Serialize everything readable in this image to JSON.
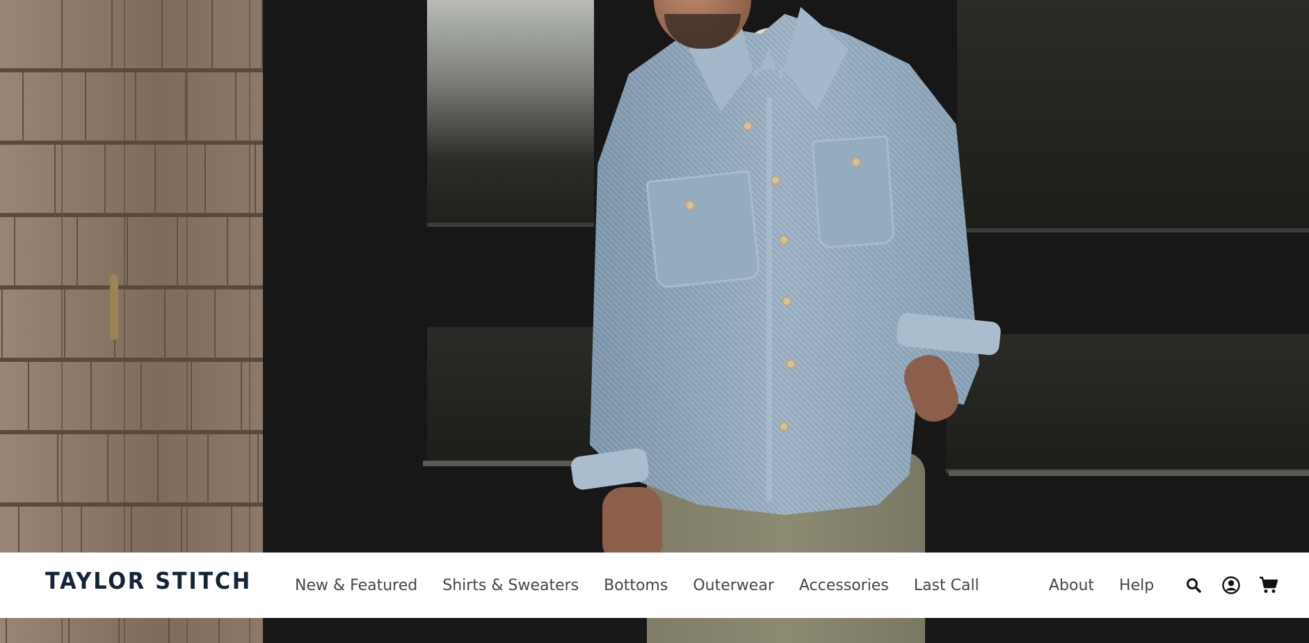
{
  "brand": {
    "name": "TAYLOR STITCH",
    "color": "#13233a"
  },
  "nav": {
    "primary": [
      {
        "label": "New & Featured"
      },
      {
        "label": "Shirts & Sweaters"
      },
      {
        "label": "Bottoms"
      },
      {
        "label": "Outerwear"
      },
      {
        "label": "Accessories"
      },
      {
        "label": "Last Call"
      }
    ],
    "utility": [
      {
        "label": "About"
      },
      {
        "label": "Help"
      }
    ],
    "icons": [
      "search-icon",
      "account-icon",
      "cart-icon"
    ]
  },
  "hero": {
    "image": "man-wearing-light-blue-chore-shirt"
  },
  "colors": {
    "navbar_bg": "#ffffff",
    "nav_text": "#454545",
    "icon": "#111111"
  }
}
